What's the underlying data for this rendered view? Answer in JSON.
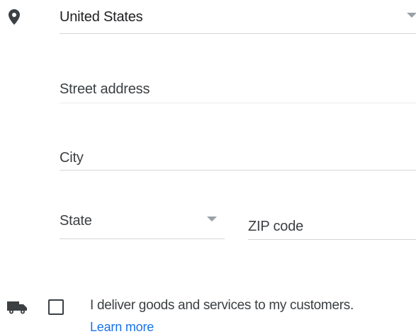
{
  "address_form": {
    "country": {
      "value": "United States",
      "icon": "location-pin-icon"
    },
    "street": {
      "placeholder": "Street address"
    },
    "city": {
      "placeholder": "City"
    },
    "state": {
      "placeholder": "State"
    },
    "zip": {
      "placeholder": "ZIP code"
    }
  },
  "delivery": {
    "icon": "truck-icon",
    "checkbox_checked": false,
    "label": "I deliver goods and services to my customers.",
    "learn_more": "Learn more"
  },
  "colors": {
    "link": "#1a73e8",
    "underline": "#d3d6da",
    "arrow": "#9aa0a6",
    "icon": "#3c4043"
  }
}
